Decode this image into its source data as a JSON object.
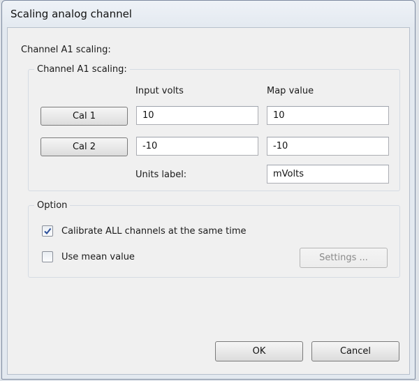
{
  "window": {
    "title": "Scaling analog channel"
  },
  "outer_label": "Channel A1 scaling:",
  "scaling": {
    "legend": "Channel A1 scaling:",
    "headers": {
      "input": "Input volts",
      "map": "Map value"
    },
    "cal1": {
      "button": "Cal 1",
      "input_volts": "10",
      "map_value": "10"
    },
    "cal2": {
      "button": "Cal 2",
      "input_volts": "-10",
      "map_value": "-10"
    },
    "units": {
      "label": "Units label:",
      "value": "mVolts"
    }
  },
  "option": {
    "legend": "Option",
    "calibrate_all": {
      "label": "Calibrate ALL channels at the same time",
      "checked": true
    },
    "use_mean": {
      "label": "Use mean value",
      "checked": false
    },
    "settings_button": "Settings ..."
  },
  "footer": {
    "ok": "OK",
    "cancel": "Cancel"
  }
}
